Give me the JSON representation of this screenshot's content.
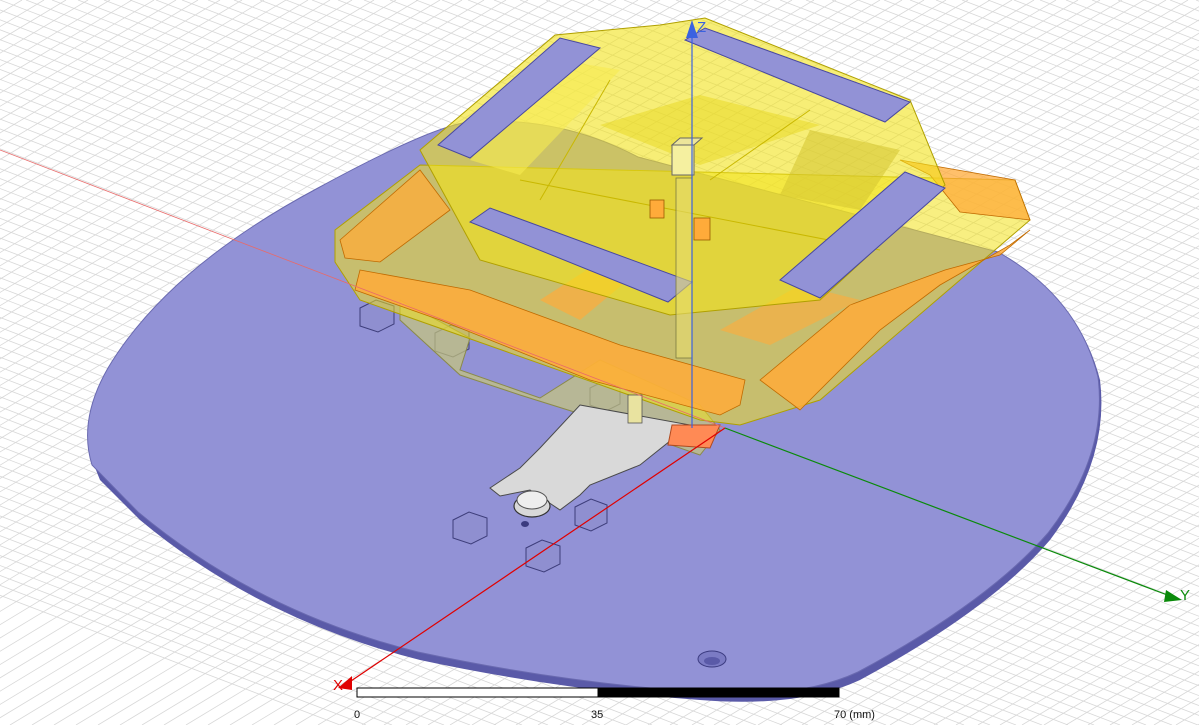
{
  "axes": {
    "x_label": "X",
    "y_label": "Y",
    "z_label": "Z"
  },
  "scale_bar": {
    "tick_0": "0",
    "tick_mid": "35",
    "tick_end": "70 (mm)"
  },
  "colors": {
    "background": "#ffffff",
    "grid": "#d8d8d8",
    "ground_plane": "#9292d6",
    "ground_edge": "#6a6ab0",
    "dielectric_yellow": "#f2e21a",
    "patch_orange": "#ffab3a",
    "patch_strip": "#9292d6",
    "feed_metal": "#d9d9d9",
    "hex_nut": "#8f8fd0",
    "x_axis": "#e00000",
    "y_axis": "#0a8a0a",
    "z_axis": "#3a62e0"
  }
}
